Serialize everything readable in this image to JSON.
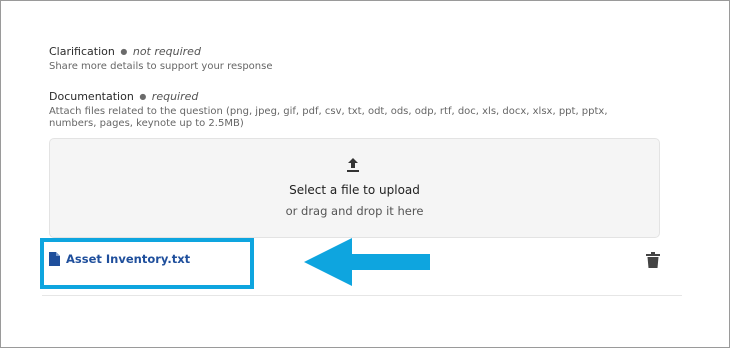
{
  "clarification": {
    "label": "Clarification",
    "status": "not required",
    "help": "Share more details to support your response"
  },
  "documentation": {
    "label": "Documentation",
    "status": "required",
    "help": "Attach files related to the question (png, jpeg, gif, pdf, csv, txt, odt, ods, odp, rtf, doc, xls, docx, xlsx, ppt, pptx, numbers, pages, keynote up to 2.5MB)"
  },
  "dropzone": {
    "title": "Select a file to upload",
    "subtitle": "or drag and drop it here",
    "icon": "upload-icon"
  },
  "attachment": {
    "file_name": "Asset Inventory.txt",
    "icon": "file-icon",
    "delete_icon": "trash-icon"
  },
  "annotation": {
    "arrow_color": "#0ea5df",
    "highlight_color": "#0ea5df"
  }
}
